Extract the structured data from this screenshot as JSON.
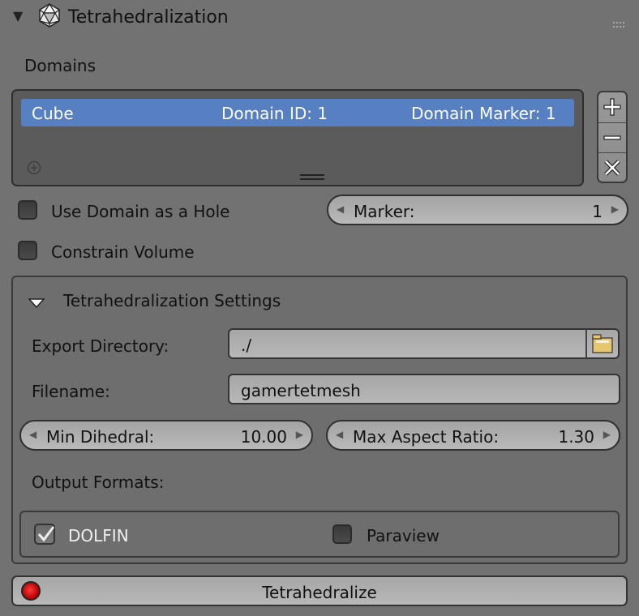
{
  "panel": {
    "title": "Tetrahedralization",
    "collapse_icon": "triangle-down-icon",
    "icon": "icosphere-icon",
    "grip_icon": "drag-grip-icon"
  },
  "domains": {
    "label": "Domains",
    "items": [
      {
        "name": "Cube",
        "domain_id": "Domain ID: 1",
        "domain_marker": "Domain Marker: 1",
        "selected": true
      }
    ],
    "side_buttons": [
      "plus-icon",
      "minus-icon",
      "x-icon"
    ]
  },
  "options": {
    "use_hole_label": "Use Domain as a Hole",
    "use_hole_checked": false,
    "marker_label": "Marker:",
    "marker_value": "1",
    "constrain_label": "Constrain Volume",
    "constrain_checked": false
  },
  "settings": {
    "title": "Tetrahedralization Settings",
    "export_dir_label": "Export Directory:",
    "export_dir_value": "./",
    "filename_label": "Filename:",
    "filename_value": "gamertetmesh",
    "min_dihedral_label": "Min Dihedral:",
    "min_dihedral_value": "10.00",
    "max_aspect_label": "Max Aspect Ratio:",
    "max_aspect_value": "1.30",
    "output_formats_label": "Output Formats:",
    "formats": [
      {
        "label": "DOLFIN",
        "checked": true
      },
      {
        "label": "Paraview",
        "checked": false
      }
    ]
  },
  "action": {
    "label": "Tetrahedralize",
    "accent": "#e01010"
  },
  "colors": {
    "background": "#727272",
    "selection": "#5680c2"
  }
}
